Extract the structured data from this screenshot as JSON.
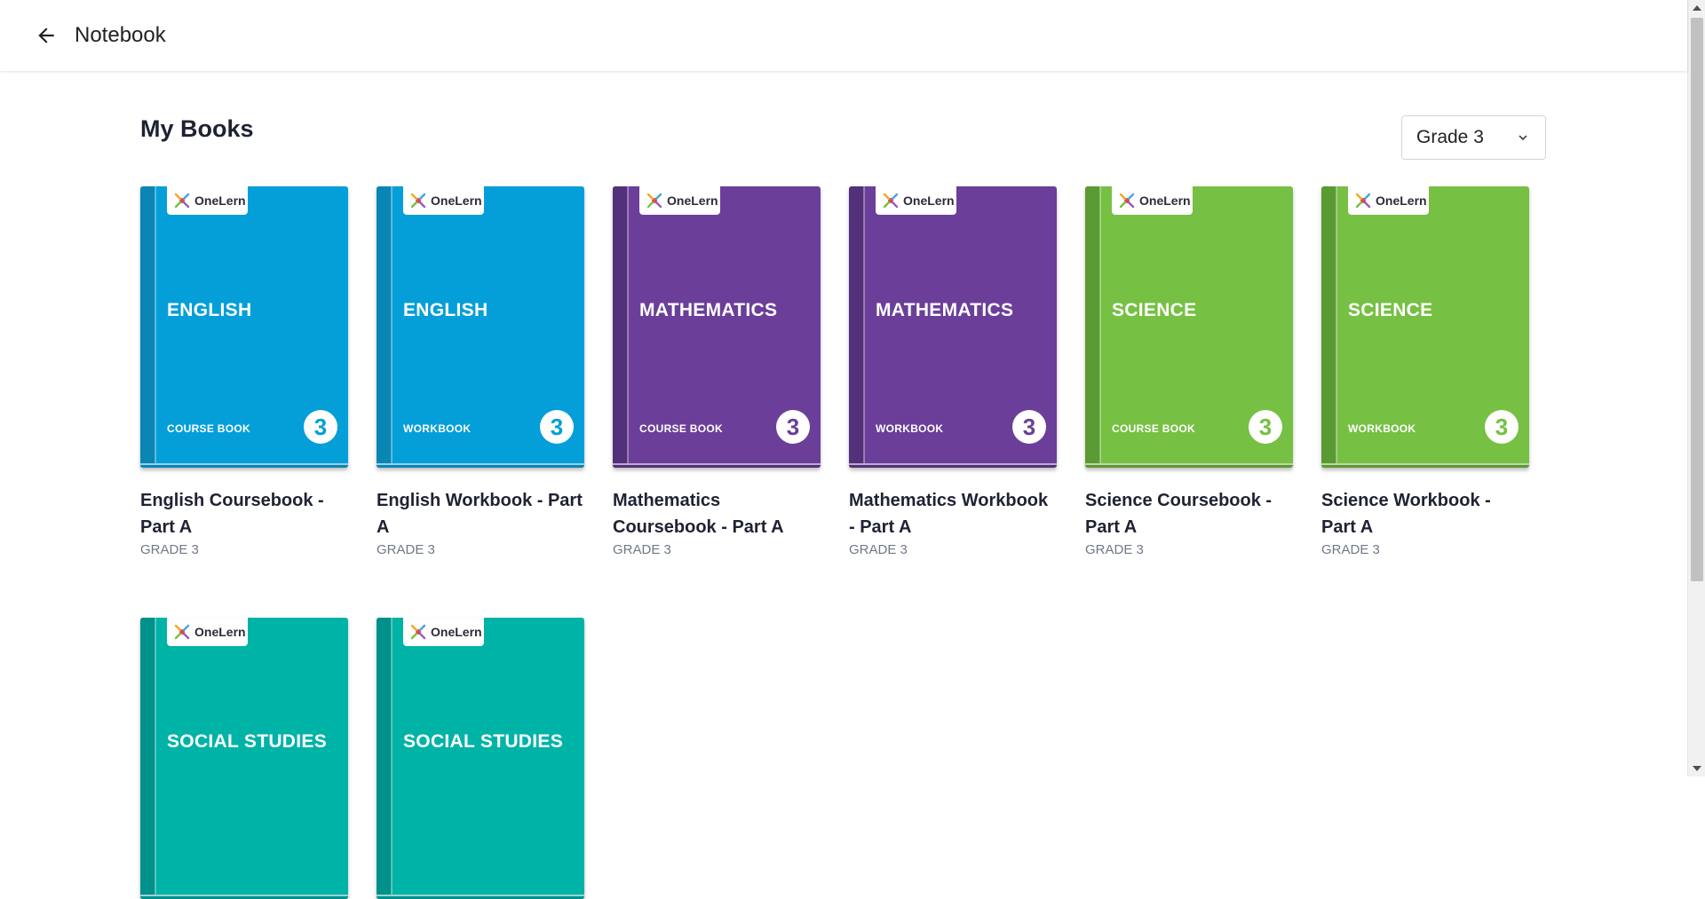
{
  "header": {
    "title": "Notebook",
    "back_icon": "arrow-left-icon"
  },
  "main": {
    "title": "My Books",
    "grade_select": {
      "value": "Grade 3",
      "icon": "chevron-down-icon"
    }
  },
  "brand": {
    "name": "OneLern"
  },
  "books": [
    {
      "subject": "ENGLISH",
      "type": "COURSE BOOK",
      "grade_number": "3",
      "title": "English Coursebook - Part A",
      "grade": "GRADE 3",
      "color": "#049fd9",
      "spine": "#0a86b5"
    },
    {
      "subject": "ENGLISH",
      "type": "WORKBOOK",
      "grade_number": "3",
      "title": "English Workbook - Part A",
      "grade": "GRADE 3",
      "color": "#049fd9",
      "spine": "#0a86b5"
    },
    {
      "subject": "MATHEMATICS",
      "type": "COURSE BOOK",
      "grade_number": "3",
      "title": "Mathematics Coursebook - Part A",
      "grade": "GRADE 3",
      "color": "#6b3f99",
      "spine": "#53307a"
    },
    {
      "subject": "MATHEMATICS",
      "type": "WORKBOOK",
      "grade_number": "3",
      "title": "Mathematics Workbook - Part A",
      "grade": "GRADE 3",
      "color": "#6b3f99",
      "spine": "#53307a"
    },
    {
      "subject": "SCIENCE",
      "type": "COURSE BOOK",
      "grade_number": "3",
      "title": "Science Coursebook - Part A",
      "grade": "GRADE 3",
      "color": "#76c043",
      "spine": "#5b9a32"
    },
    {
      "subject": "SCIENCE",
      "type": "WORKBOOK",
      "grade_number": "3",
      "title": "Science Workbook - Part A",
      "grade": "GRADE 3",
      "color": "#76c043",
      "spine": "#5b9a32"
    },
    {
      "subject": "SOCIAL STUDIES",
      "type": "",
      "grade_number": "",
      "title": "",
      "grade": "",
      "color": "#00b3a7",
      "spine": "#00918a"
    },
    {
      "subject": "SOCIAL STUDIES",
      "type": "",
      "grade_number": "",
      "title": "",
      "grade": "",
      "color": "#00b3a7",
      "spine": "#00918a"
    }
  ]
}
